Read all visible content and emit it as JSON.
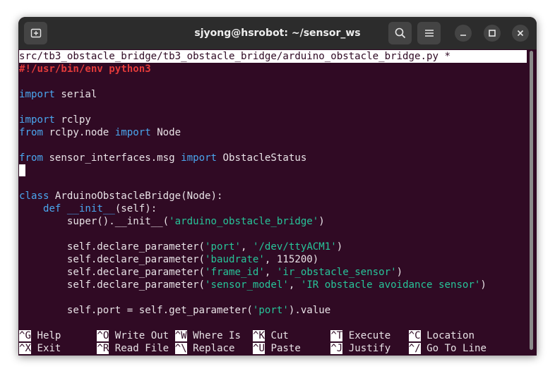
{
  "window": {
    "title": "sjyong@hsrobot: ~/sensor_ws"
  },
  "icons": {
    "new_tab": "new-tab-icon",
    "search": "search-icon",
    "menu": "hamburger-menu-icon",
    "minimize": "minimize-icon",
    "maximize": "maximize-icon",
    "close": "close-icon"
  },
  "editor": {
    "filename": "src/tb3_obstacle_bridge/tb3_obstacle_bridge/arduino_obstacle_bridge.py *",
    "code": {
      "l1": "#!/usr/bin/env python3",
      "l2_kw": "import",
      "l2_a": " serial",
      "l3_kw": "import",
      "l3_a": " rclpy",
      "l4_kw1": "from",
      "l4_a": " rclpy.node ",
      "l4_kw2": "import",
      "l4_b": " Node",
      "l5_kw1": "from",
      "l5_a": " sensor_interfaces.msg ",
      "l5_kw2": "import",
      "l5_b": " ObstacleStatus",
      "l6_kw": "class",
      "l6_a": " ArduinoObstacleBridge(Node):",
      "l7_indent": "    ",
      "l7_kw1": "def",
      "l7_sp": " ",
      "l7_kw2": "__init__",
      "l7_a": "(self):",
      "l8_a": "        super().__init__(",
      "l8_s": "'arduino_obstacle_bridge'",
      "l8_b": ")",
      "l9_a": "        self.declare_parameter(",
      "l9_s1": "'port'",
      "l9_b": ", ",
      "l9_s2": "'/dev/ttyACM1'",
      "l9_c": ")",
      "l10_a": "        self.declare_parameter(",
      "l10_s1": "'baudrate'",
      "l10_b": ", 115200)",
      "l11_a": "        self.declare_parameter(",
      "l11_s1": "'frame_id'",
      "l11_b": ", ",
      "l11_s2": "'ir_obstacle_sensor'",
      "l11_c": ")",
      "l12_a": "        self.declare_parameter(",
      "l12_s1": "'sensor_model'",
      "l12_b": ", ",
      "l12_s2": "'IR obstacle avoidance sensor'",
      "l12_c": ")",
      "l13_a": "        self.port = self.get_parameter(",
      "l13_s": "'port'",
      "l13_b": ").value"
    }
  },
  "shortcuts": [
    {
      "key": "^G",
      "label": " Help      "
    },
    {
      "key": "^O",
      "label": " Write Out "
    },
    {
      "key": "^W",
      "label": " Where Is  "
    },
    {
      "key": "^K",
      "label": " Cut       "
    },
    {
      "key": "^T",
      "label": " Execute   "
    },
    {
      "key": "^C",
      "label": " Location"
    },
    {
      "key": "^X",
      "label": " Exit      "
    },
    {
      "key": "^R",
      "label": " Read File "
    },
    {
      "key": "^\\",
      "label": " Replace   "
    },
    {
      "key": "^U",
      "label": " Paste     "
    },
    {
      "key": "^J",
      "label": " Justify   "
    },
    {
      "key": "^/",
      "label": " Go To Line"
    }
  ]
}
